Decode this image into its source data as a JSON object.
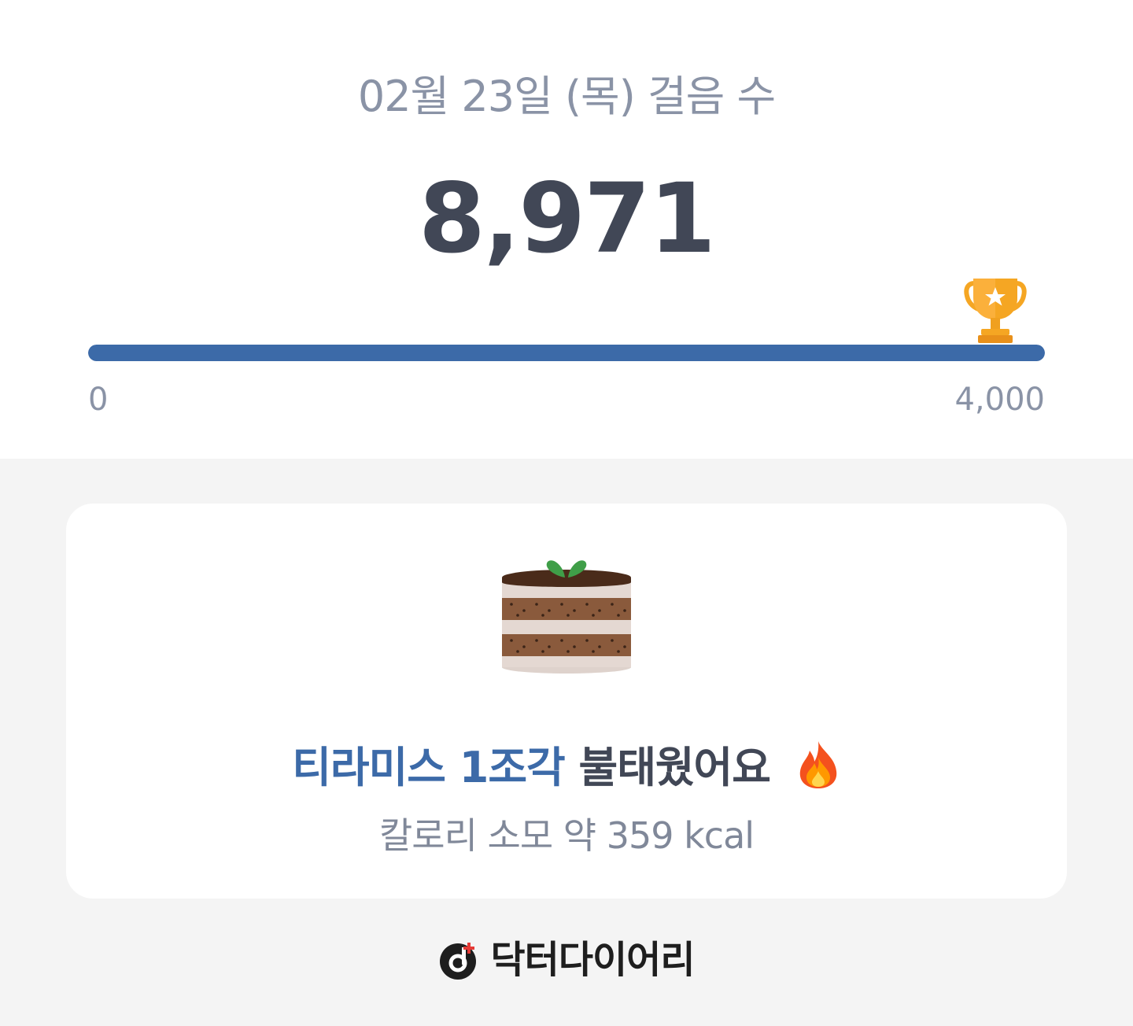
{
  "header": {
    "title": "02월 23일 (목) 걸음 수",
    "steps": "8,971"
  },
  "progress": {
    "value": 8971,
    "goal": 4000,
    "fill_fraction": 1.0,
    "min_label": "0",
    "max_label": "4,000",
    "goal_icon": "trophy-icon",
    "bar_color": "#3c6aa8"
  },
  "burn_card": {
    "image": "tiramisu-cake-icon",
    "food": "티라미스 1조각",
    "message": "불태웠어요",
    "emoji": "fire-icon",
    "calorie_text": "칼로리 소모 약 359 kcal"
  },
  "brand": {
    "logo": "doctor-diary-logo-icon",
    "name": "닥터다이어리"
  },
  "colors": {
    "accent": "#3c6aa8",
    "text_dark": "#414756",
    "text_muted": "#8a93a6",
    "background": "#f4f4f4"
  }
}
